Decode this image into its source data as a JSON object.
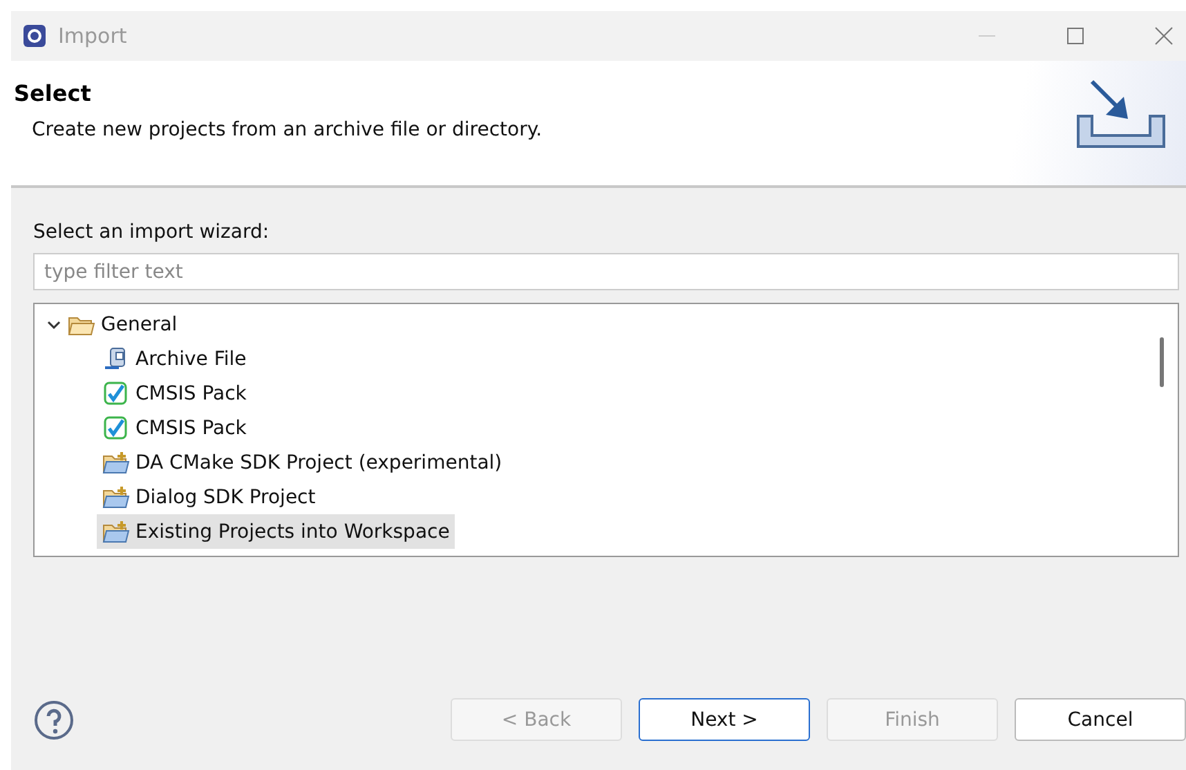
{
  "window": {
    "title": "Import"
  },
  "header": {
    "title": "Select",
    "description": "Create new projects from an archive file or directory."
  },
  "wizard_label": "Select an import wizard:",
  "filter": {
    "placeholder": "type filter text"
  },
  "tree": [
    {
      "label": "General",
      "kind": "folder",
      "expanded": true,
      "selected": false,
      "children": [
        {
          "label": "Archive File",
          "kind": "archive",
          "selected": false
        },
        {
          "label": "CMSIS Pack",
          "kind": "cmsis",
          "selected": false
        },
        {
          "label": "CMSIS Pack",
          "kind": "cmsis",
          "selected": false
        },
        {
          "label": "DA CMake SDK Project (experimental)",
          "kind": "project",
          "selected": false
        },
        {
          "label": "Dialog SDK Project",
          "kind": "project",
          "selected": false
        },
        {
          "label": "Existing Projects into Workspace",
          "kind": "project",
          "selected": true
        }
      ]
    }
  ],
  "buttons": [
    {
      "label": "< Back",
      "disabled": true,
      "default": false
    },
    {
      "label": "Next >",
      "disabled": false,
      "default": true
    },
    {
      "label": "Finish",
      "disabled": true,
      "default": false
    },
    {
      "label": "Cancel",
      "disabled": false,
      "default": false
    }
  ]
}
